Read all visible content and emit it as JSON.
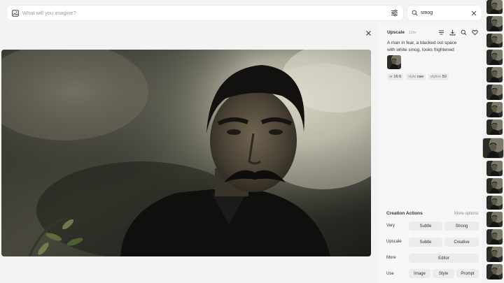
{
  "prompt_bar": {
    "placeholder": "What will you imagine?",
    "image_icon": "image-icon",
    "settings_icon": "sliders-icon"
  },
  "search": {
    "value": "smog",
    "icon": "search-icon",
    "clear_icon": "close-icon"
  },
  "main": {
    "close_icon": "close-icon"
  },
  "panel": {
    "title": "Upscale",
    "time": "11hr",
    "icons": [
      "menu-icon",
      "download-icon",
      "search-icon",
      "heart-icon"
    ],
    "prompt": "A man in fear, a blacked out space with white smog, looks frightened",
    "params": [
      {
        "key": "ar",
        "value": "16:9"
      },
      {
        "key": "style",
        "value": "raw"
      },
      {
        "key": "stylize",
        "value": "50"
      }
    ],
    "actions_title": "Creation Actions",
    "more_options": "More options",
    "vary": {
      "label": "Vary",
      "buttons": [
        "Subtle",
        "Strong"
      ]
    },
    "upscale": {
      "label": "Upscale",
      "buttons": [
        "Subtle",
        "Creative"
      ]
    },
    "more": {
      "label": "More",
      "buttons": [
        "Editor"
      ]
    },
    "use": {
      "label": "Use",
      "buttons": [
        "Image",
        "Style",
        "Prompt"
      ]
    }
  },
  "colors": {
    "background": "#f3f3f3",
    "panel": "#f7f7f7",
    "button": "#ebebeb"
  }
}
